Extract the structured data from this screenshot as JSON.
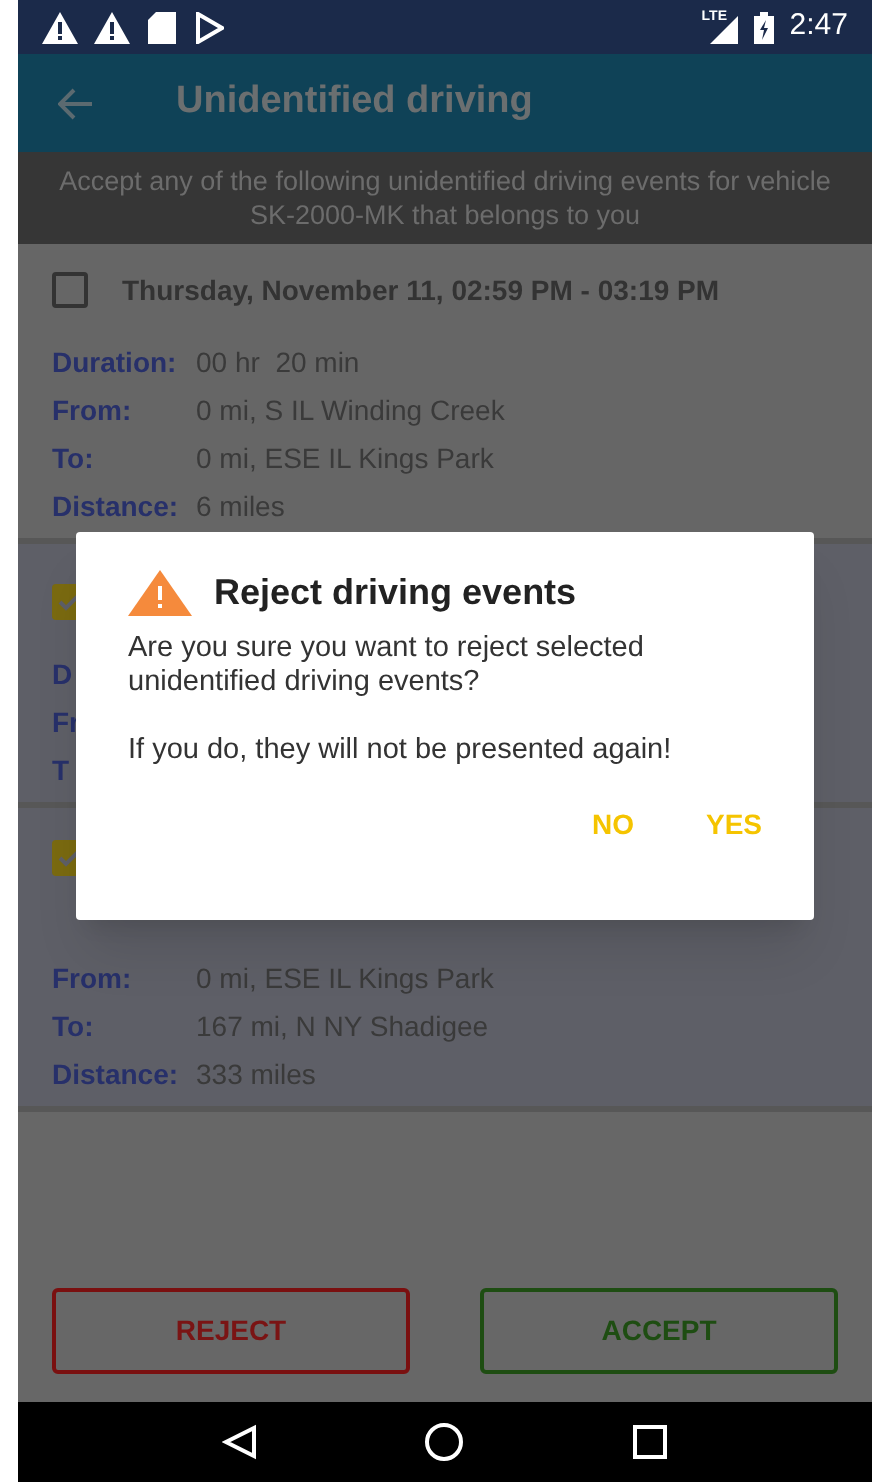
{
  "status_bar": {
    "time": "2:47",
    "network": "LTE"
  },
  "app_bar": {
    "title": "Unidentified driving"
  },
  "banner": "Accept any of the following unidentified driving events for vehicle SK-2000-MK that belongs to you",
  "cards": [
    {
      "checked": false,
      "title": "Thursday, November 11, 02:59 PM - 03:19 PM",
      "rows": [
        {
          "label": "Duration:",
          "value": "00 hr  20 min"
        },
        {
          "label": "From:",
          "value": "0 mi, S IL Winding Creek"
        },
        {
          "label": "To:",
          "value": "0 mi, ESE IL Kings Park"
        },
        {
          "label": "Distance:",
          "value": "6 miles"
        }
      ]
    },
    {
      "checked": true,
      "rows": [
        {
          "label": "D"
        },
        {
          "label": "Fr"
        },
        {
          "label": "T"
        }
      ]
    },
    {
      "checked": true,
      "rows": [
        {
          "label": "From:",
          "value": "0 mi, ESE IL Kings Park"
        },
        {
          "label": "To:",
          "value": "167 mi, N NY Shadigee"
        },
        {
          "label": "Distance:",
          "value": "333 miles"
        }
      ]
    }
  ],
  "buttons": [
    {
      "label": "REJECT",
      "kind": "reject"
    },
    {
      "label": "ACCEPT",
      "kind": "accept"
    }
  ],
  "dialog": {
    "title": "Reject driving events",
    "paragraphs": [
      "Are you sure you want to reject selected unidentified driving events?",
      "If you do, they will not be presented again!"
    ],
    "actions": [
      "NO",
      "YES"
    ]
  }
}
